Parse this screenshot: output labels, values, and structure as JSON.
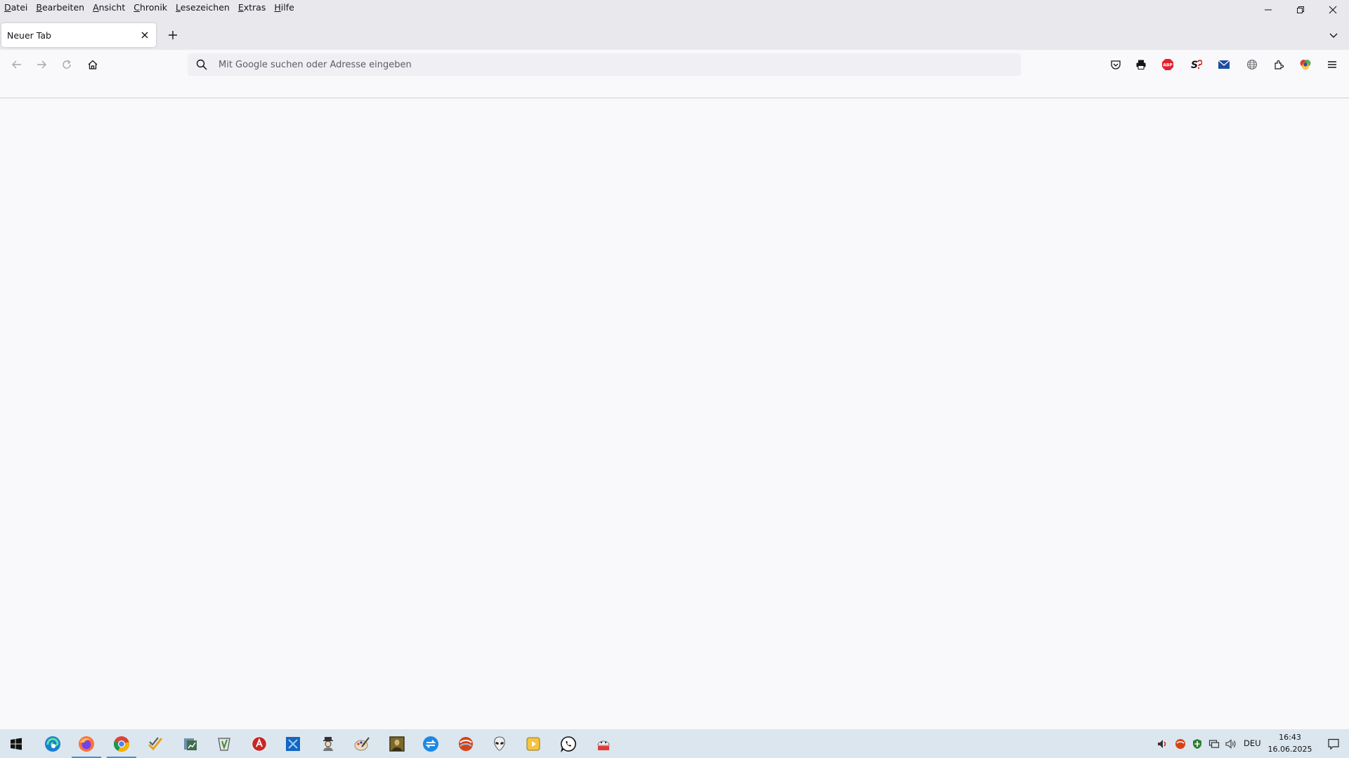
{
  "menubar": {
    "items": [
      {
        "label": "Datei",
        "accel": "D",
        "rest": "atei"
      },
      {
        "label": "Bearbeiten",
        "accel": "B",
        "rest": "earbeiten"
      },
      {
        "label": "Ansicht",
        "accel": "A",
        "rest": "nsicht"
      },
      {
        "label": "Chronik",
        "accel": "C",
        "rest": "hronik"
      },
      {
        "label": "Lesezeichen",
        "accel": "L",
        "rest": "esezeichen"
      },
      {
        "label": "Extras",
        "accel": "E",
        "rest": "xtras"
      },
      {
        "label": "Hilfe",
        "accel": "H",
        "rest": "ilfe"
      }
    ]
  },
  "window_controls": [
    "minimize-icon",
    "restore-icon",
    "close-icon"
  ],
  "tabs": [
    {
      "title": "Neuer Tab",
      "active": true
    }
  ],
  "navbar": {
    "urlbar_placeholder": "Mit Google suchen oder Adresse eingeben",
    "urlbar_value": ""
  },
  "toolbar_icons": [
    "pocket-icon",
    "print-icon",
    "adblock-plus-icon",
    "extension-s-icon",
    "mail-icon",
    "translate-globe-icon",
    "extensions-puzzle-icon",
    "color-picker-icon",
    "app-menu-icon"
  ],
  "taskbar": {
    "apps": [
      "edge-icon",
      "firefox-icon",
      "chrome-icon",
      "tasks-icon",
      "finance-icon",
      "cleaner-icon",
      "red-app-icon",
      "blue-app-icon",
      "character-icon",
      "brush-icon",
      "mona-lisa-icon",
      "sync-icon",
      "layers-app-icon",
      "alien-icon",
      "video-player-icon",
      "whatsapp-icon",
      "pdf24-icon"
    ],
    "active_apps": [
      "firefox-icon",
      "chrome-icon"
    ],
    "language": "DEU",
    "time": "16:43",
    "date": "16.06.2025"
  },
  "colors": {
    "chrome_bg": "#e9e8ed",
    "content_bg": "#f9f9fb",
    "taskbar_bg": "#dbe6ef",
    "accent": "#4a8fd6"
  }
}
